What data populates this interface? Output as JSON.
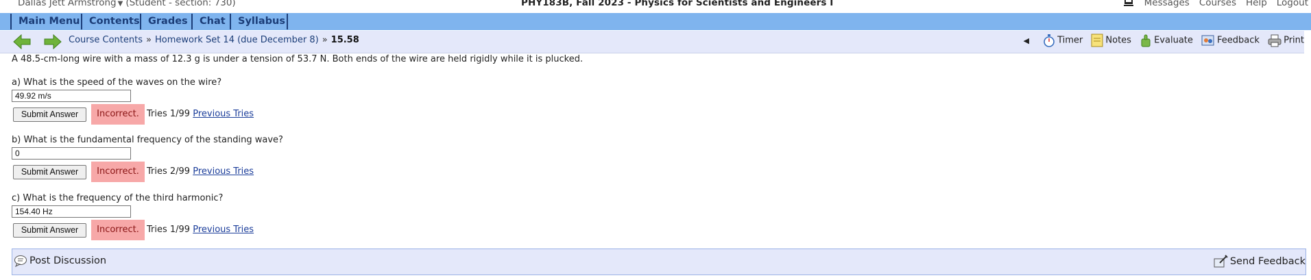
{
  "topbar": {
    "user_name": "Dallas Jett Armstrong",
    "user_role": "(Student  - section: 730)",
    "course_title": "PHY183B, Fall 2023 - Physics for Scientists and Engineers I",
    "links": {
      "messages": "Messages",
      "courses": "Courses",
      "help": "Help",
      "logout": "Logout"
    }
  },
  "menu": {
    "main_menu": "Main Menu",
    "contents": "Contents",
    "grades": "Grades",
    "chat": "Chat",
    "syllabus": "Syllabus"
  },
  "nav": {
    "crumb_course_contents": "Course Contents",
    "crumb_homework": "Homework Set 14 (due December 8)",
    "crumb_current": "15.58",
    "separator": "»",
    "tools": {
      "timer": "Timer",
      "notes": "Notes",
      "evaluate": "Evaluate",
      "feedback": "Feedback",
      "print": "Print"
    }
  },
  "problem": {
    "statement": "A 48.5-cm-long wire with a mass of 12.3 g is under a tension of 53.7 N. Both ends of the wire are held rigidly while it is plucked.",
    "parts": [
      {
        "question": "a) What is the speed of the waves on the wire?",
        "answer": "49.92 m/s",
        "submit_label": "Submit Answer",
        "status": "Incorrect.",
        "tries": "Tries 1/99",
        "previous_tries": "Previous Tries"
      },
      {
        "question": "b) What is the fundamental frequency of the standing wave?",
        "answer": "0",
        "submit_label": "Submit Answer",
        "status": "Incorrect.",
        "tries": "Tries 2/99",
        "previous_tries": "Previous Tries"
      },
      {
        "question": "c) What is the frequency of the third harmonic?",
        "answer": "154.40 Hz",
        "submit_label": "Submit Answer",
        "status": "Incorrect.",
        "tries": "Tries 1/99",
        "previous_tries": "Previous Tries"
      }
    ]
  },
  "bottom": {
    "post_discussion": "Post Discussion",
    "send_feedback": "Send Feedback"
  },
  "colors": {
    "menu_bar": "#7fb4ee",
    "nav_bar": "#e4e8fa",
    "incorrect_bg": "#f7a8a8",
    "link": "#1b3d9a",
    "arrow_green": "#5aa02c"
  }
}
